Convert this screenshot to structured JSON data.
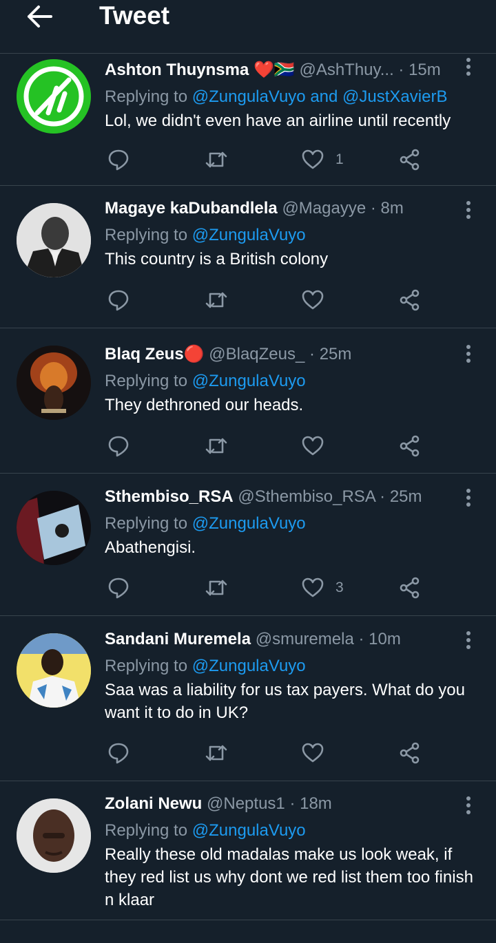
{
  "header": {
    "title": "Tweet"
  },
  "reply_prefix": "Replying to",
  "tweets": [
    {
      "name": "Ashton Thuynsma ❤️🇿🇦",
      "handle": "@AshThuy...",
      "time": "· 15m",
      "replying": "@ZungulaVuyo and @JustXavierB",
      "text": "Lol, we didn't even have an airline until recently",
      "likes": "1",
      "avatar": "green-logo"
    },
    {
      "name": "Magaye kaDubandlela",
      "handle": "@Magayye",
      "time": "· 8m",
      "replying": "@ZungulaVuyo",
      "text": "This country is a British colony",
      "likes": "",
      "avatar": "bw-photo"
    },
    {
      "name": "Blaq Zeus🔴",
      "handle": "@BlaqZeus_",
      "time": "· 25m",
      "replying": "@ZungulaVuyo",
      "text": "They dethroned our heads.",
      "likes": "",
      "avatar": "lion-portrait"
    },
    {
      "name": "Sthembiso_RSA",
      "handle": "@Sthembiso_RSA",
      "time": "· 25m",
      "replying": "@ZungulaVuyo",
      "text": "Abathengisi.",
      "likes": "3",
      "avatar": "flag-photo"
    },
    {
      "name": "Sandani Muremela",
      "handle": "@smuremela",
      "time": "· 10m",
      "replying": "@ZungulaVuyo",
      "text": "Saa was a liability for us tax payers. What do you want it to do in UK?",
      "likes": "",
      "avatar": "person-yellow"
    },
    {
      "name": "Zolani Newu",
      "handle": "@Neptus1",
      "time": "· 18m",
      "replying": "@ZungulaVuyo",
      "text": "Really these old madalas make us look weak, if they red list us why dont we red list them too finish n klaar",
      "likes": "",
      "avatar": "face-photo"
    }
  ],
  "colors": {
    "background": "#15202b",
    "separator": "#38444d",
    "secondary_text": "#8b98a5",
    "link": "#1d9bf0"
  }
}
